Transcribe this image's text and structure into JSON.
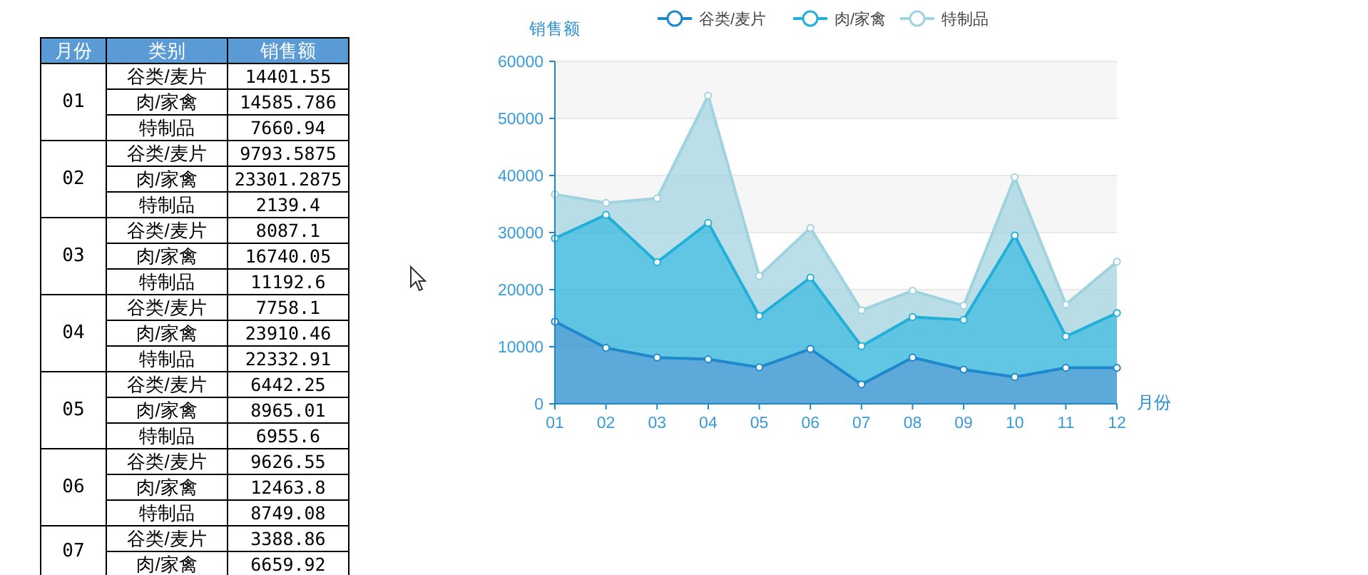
{
  "table": {
    "columns": [
      "月份",
      "类别",
      "销售额"
    ],
    "groups": [
      {
        "month": "01",
        "rows": [
          {
            "category": "谷类/麦片",
            "sales": "14401.55"
          },
          {
            "category": "肉/家禽",
            "sales": "14585.786"
          },
          {
            "category": "特制品",
            "sales": "7660.94"
          }
        ]
      },
      {
        "month": "02",
        "rows": [
          {
            "category": "谷类/麦片",
            "sales": "9793.5875"
          },
          {
            "category": "肉/家禽",
            "sales": "23301.2875"
          },
          {
            "category": "特制品",
            "sales": "2139.4"
          }
        ]
      },
      {
        "month": "03",
        "rows": [
          {
            "category": "谷类/麦片",
            "sales": "8087.1"
          },
          {
            "category": "肉/家禽",
            "sales": "16740.05"
          },
          {
            "category": "特制品",
            "sales": "11192.6"
          }
        ]
      },
      {
        "month": "04",
        "rows": [
          {
            "category": "谷类/麦片",
            "sales": "7758.1"
          },
          {
            "category": "肉/家禽",
            "sales": "23910.46"
          },
          {
            "category": "特制品",
            "sales": "22332.91"
          }
        ]
      },
      {
        "month": "05",
        "rows": [
          {
            "category": "谷类/麦片",
            "sales": "6442.25"
          },
          {
            "category": "肉/家禽",
            "sales": "8965.01"
          },
          {
            "category": "特制品",
            "sales": "6955.6"
          }
        ]
      },
      {
        "month": "06",
        "rows": [
          {
            "category": "谷类/麦片",
            "sales": "9626.55"
          },
          {
            "category": "肉/家禽",
            "sales": "12463.8"
          },
          {
            "category": "特制品",
            "sales": "8749.08"
          }
        ]
      },
      {
        "month": "07",
        "rows": [
          {
            "category": "谷类/麦片",
            "sales": "3388.86"
          },
          {
            "category": "肉/家禽",
            "sales": "6659.92"
          }
        ]
      }
    ]
  },
  "chart": {
    "chart_data": {
      "type": "area",
      "stacked": true,
      "ylabel": "销售额",
      "xlabel": "月份",
      "categories": [
        "01",
        "02",
        "03",
        "04",
        "05",
        "06",
        "07",
        "08",
        "09",
        "10",
        "11",
        "12"
      ],
      "series": [
        {
          "name": "谷类/麦片",
          "color": "#1e88cc",
          "values": [
            14400,
            9800,
            8100,
            7800,
            6400,
            9600,
            3400,
            8100,
            6000,
            4700,
            6300,
            6300
          ]
        },
        {
          "name": "肉/家禽",
          "color": "#22b0d8",
          "values": [
            14600,
            23300,
            16700,
            23900,
            9000,
            12500,
            6700,
            7100,
            8700,
            24800,
            5500,
            9600
          ]
        },
        {
          "name": "特制品",
          "color": "#9fd3df",
          "values": [
            7700,
            2100,
            11200,
            22300,
            7000,
            8700,
            6300,
            4600,
            2500,
            10200,
            5600,
            9000
          ]
        }
      ],
      "grid": true,
      "legend": true,
      "ylim": [
        0,
        60000
      ],
      "yticks": [
        0,
        10000,
        20000,
        30000,
        40000,
        50000,
        60000
      ]
    }
  }
}
